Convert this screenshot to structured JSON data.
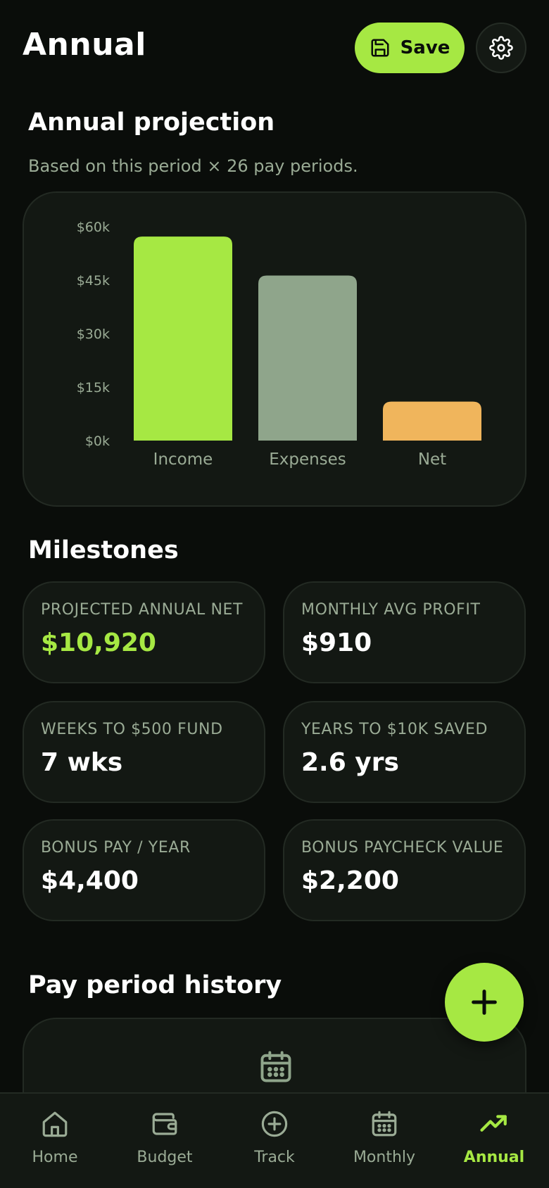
{
  "header": {
    "title": "Annual",
    "save_label": "Save"
  },
  "projection": {
    "title": "Annual projection",
    "subtitle": "Based on this period × 26 pay periods."
  },
  "chart_data": {
    "type": "bar",
    "categories": [
      "Income",
      "Expenses",
      "Net"
    ],
    "values": [
      57200,
      46280,
      10920
    ],
    "colors": [
      "#a6e843",
      "#8fa58b",
      "#f0b55c"
    ],
    "yticks": [
      "$0k",
      "$15k",
      "$30k",
      "$45k",
      "$60k"
    ],
    "ytick_values": [
      0,
      15000,
      30000,
      45000,
      60000
    ],
    "ylim": [
      0,
      60000
    ],
    "grid": false
  },
  "milestones": {
    "title": "Milestones",
    "items": [
      {
        "label": "PROJECTED ANNUAL NET",
        "value": "$10,920",
        "accent": true
      },
      {
        "label": "MONTHLY AVG PROFIT",
        "value": "$910",
        "accent": false
      },
      {
        "label": "WEEKS TO $500 FUND",
        "value": "7 wks",
        "accent": false
      },
      {
        "label": "YEARS TO $10K SAVED",
        "value": "2.6 yrs",
        "accent": false
      },
      {
        "label": "BONUS PAY / YEAR",
        "value": "$4,400",
        "accent": false
      },
      {
        "label": "BONUS PAYCHECK VALUE",
        "value": "$2,200",
        "accent": false
      }
    ]
  },
  "history": {
    "title": "Pay period history"
  },
  "nav": {
    "items": [
      {
        "label": "Home",
        "icon": "home-icon"
      },
      {
        "label": "Budget",
        "icon": "wallet-icon"
      },
      {
        "label": "Track",
        "icon": "plus-circle-icon"
      },
      {
        "label": "Monthly",
        "icon": "calendar-icon"
      },
      {
        "label": "Annual",
        "icon": "trending-up-icon",
        "active": true
      }
    ]
  },
  "colors": {
    "accent": "#a6e843",
    "background": "#0a0d0a",
    "card": "#131813",
    "muted_text": "#9aab95"
  }
}
